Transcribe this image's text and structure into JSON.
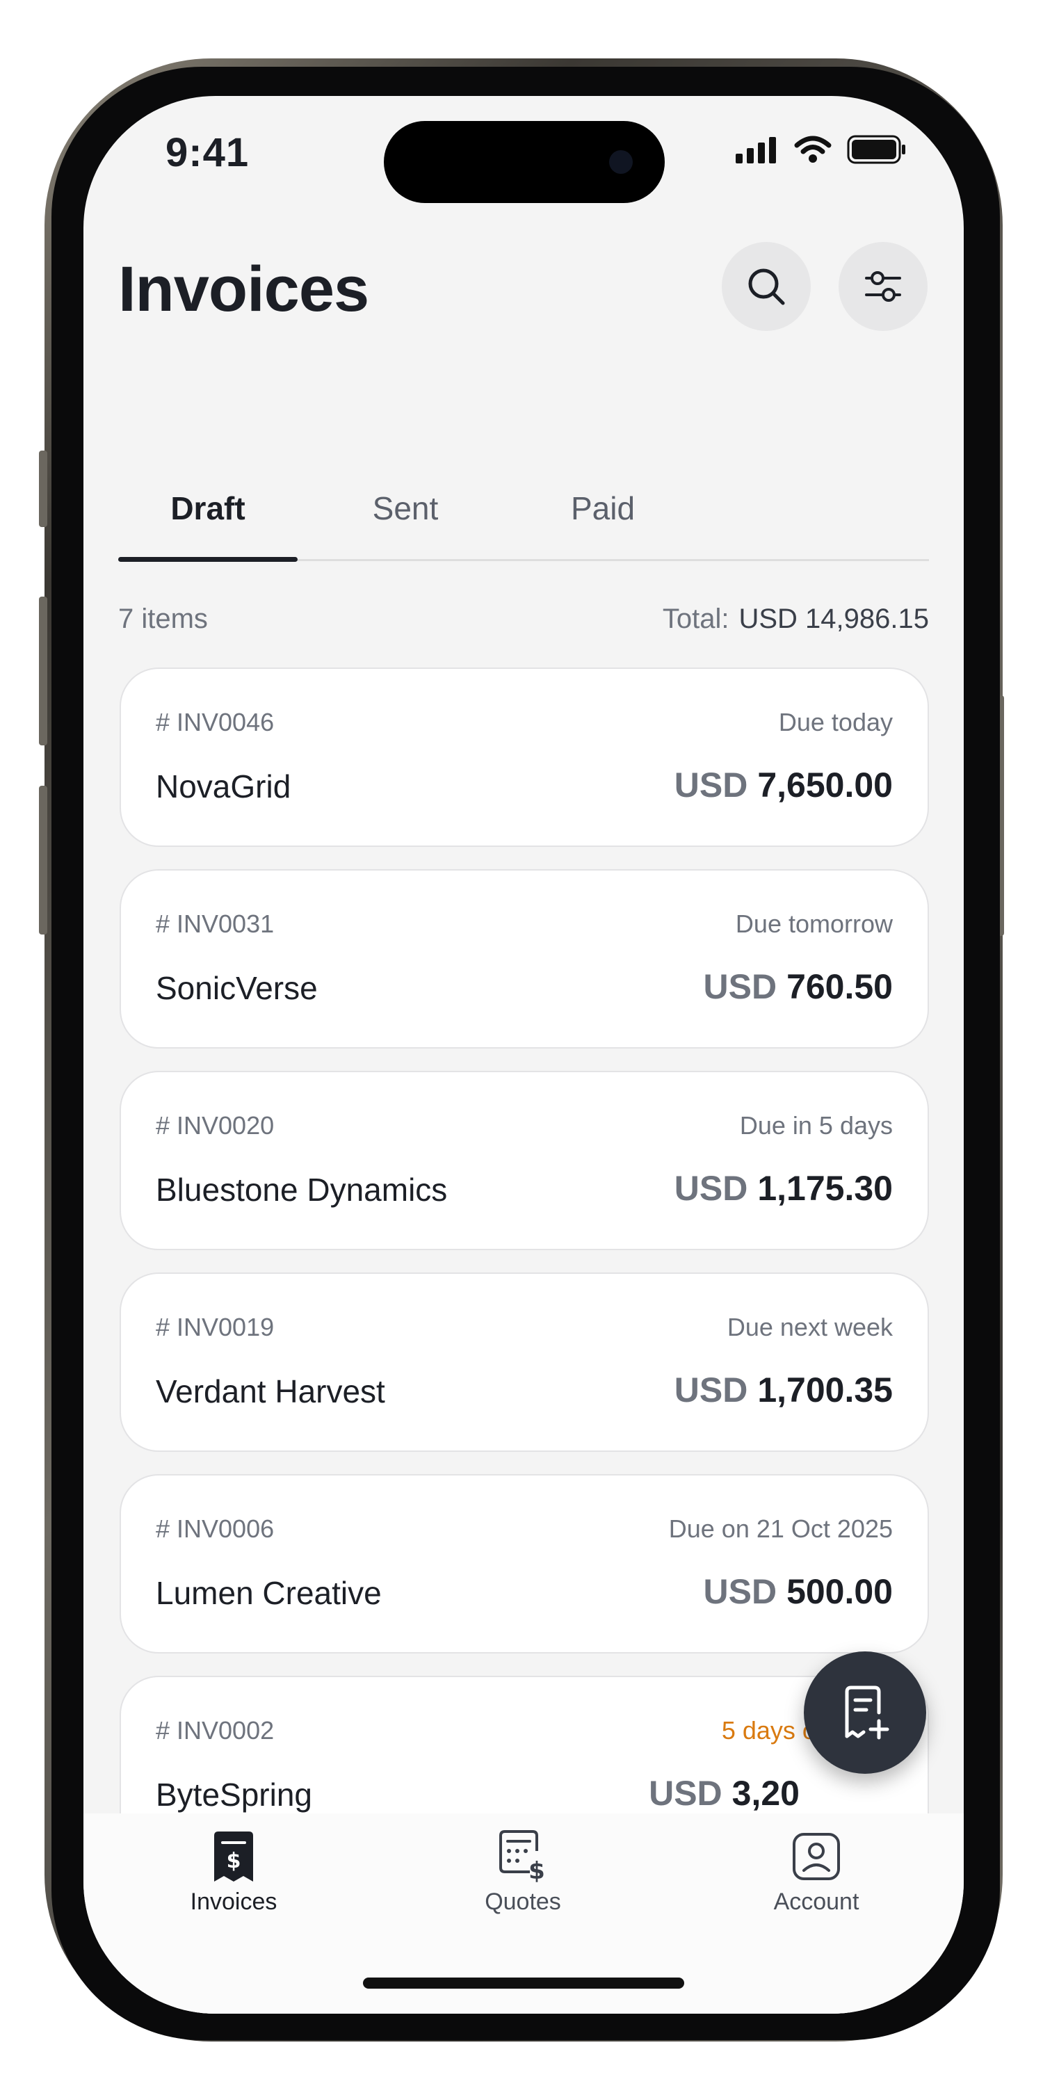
{
  "status_bar": {
    "time": "9:41"
  },
  "header": {
    "title": "Invoices"
  },
  "tabs": [
    {
      "label": "Draft",
      "active": true
    },
    {
      "label": "Sent",
      "active": false
    },
    {
      "label": "Paid",
      "active": false
    }
  ],
  "summary": {
    "count": "7 items",
    "total_label": "Total:",
    "total_value": "USD 14,986.15"
  },
  "invoices": [
    {
      "number": "# INV0046",
      "due": "Due today",
      "client": "NovaGrid",
      "currency": "USD",
      "amount": "7,650.00"
    },
    {
      "number": "# INV0031",
      "due": "Due tomorrow",
      "client": "SonicVerse",
      "currency": "USD",
      "amount": "760.50"
    },
    {
      "number": "# INV0020",
      "due": "Due in 5 days",
      "client": "Bluestone Dynamics",
      "currency": "USD",
      "amount": "1,175.30"
    },
    {
      "number": "# INV0019",
      "due": "Due next week",
      "client": "Verdant Harvest",
      "currency": "USD",
      "amount": "1,700.35"
    },
    {
      "number": "# INV0006",
      "due": "Due on 21 Oct 2025",
      "client": "Lumen Creative",
      "currency": "USD",
      "amount": "500.00"
    },
    {
      "number": "# INV0002",
      "due": "5 days overdue",
      "client": "ByteSpring",
      "currency": "USD",
      "amount": "3,20",
      "overdue": true
    }
  ],
  "bottom_nav": [
    {
      "label": "Invoices",
      "icon": "invoice-dollar-icon",
      "active": true
    },
    {
      "label": "Quotes",
      "icon": "quote-dollar-icon",
      "active": false
    },
    {
      "label": "Account",
      "icon": "account-icon",
      "active": false
    }
  ],
  "fab": {
    "icon": "new-invoice-icon"
  },
  "colors": {
    "accent": "#1c1f26",
    "overdue": "#d97a10",
    "background": "#f4f4f4",
    "card": "#ffffff",
    "fab": "#2e333d"
  }
}
